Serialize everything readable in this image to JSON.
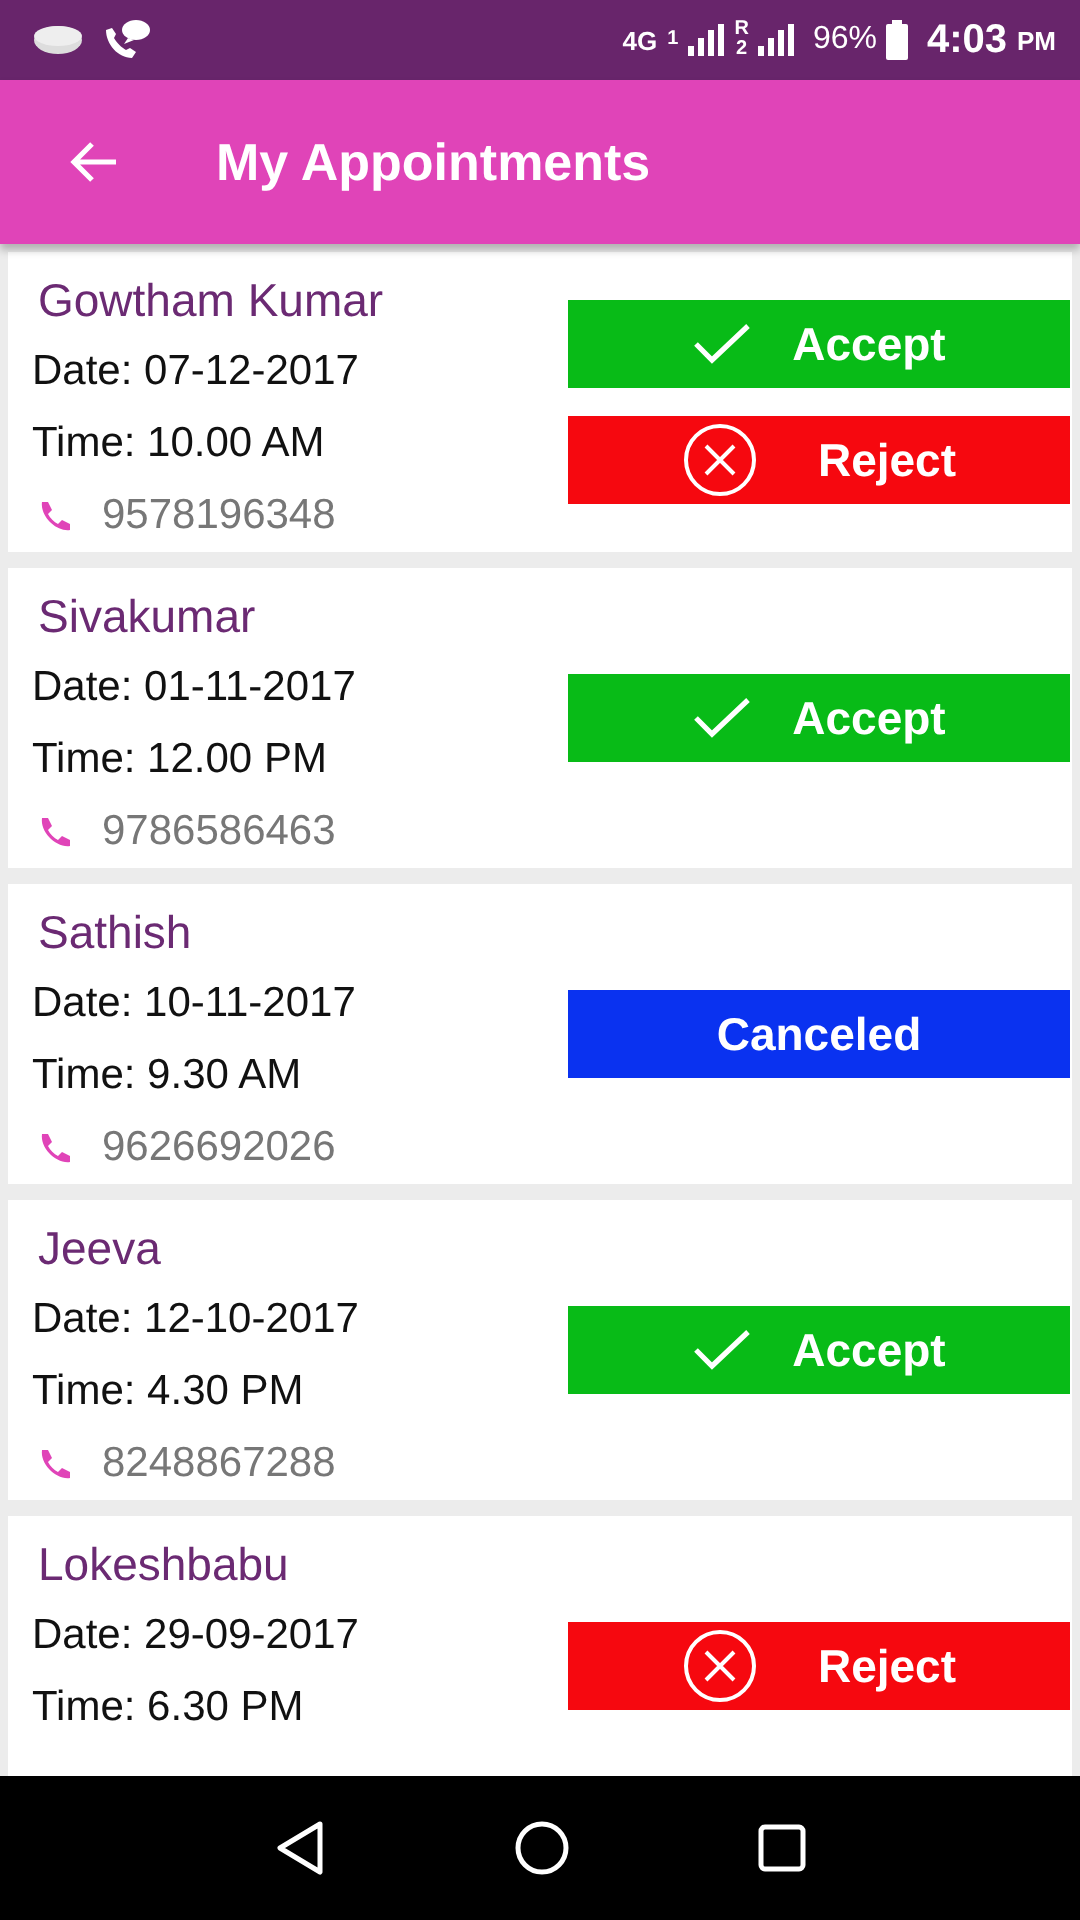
{
  "status_bar": {
    "network": "4G",
    "sim1": "1",
    "roaming": "R",
    "sim2": "2",
    "battery": "96%",
    "time": "4:03",
    "time_suffix": "PM"
  },
  "header": {
    "title": "My Appointments"
  },
  "appointments": [
    {
      "name": "Gowtham Kumar",
      "date": "Date: 07-12-2017",
      "time": "Time: 10.00 AM",
      "phone": "9578196348",
      "actions": [
        {
          "kind": "accept",
          "label": "Accept"
        },
        {
          "kind": "reject",
          "label": "Reject"
        }
      ]
    },
    {
      "name": "Sivakumar",
      "date": "Date: 01-11-2017",
      "time": "Time: 12.00 PM",
      "phone": "9786586463",
      "actions": [
        {
          "kind": "accept",
          "label": "Accept"
        }
      ]
    },
    {
      "name": "Sathish",
      "date": "Date: 10-11-2017",
      "time": "Time: 9.30 AM",
      "phone": "9626692026",
      "actions": [
        {
          "kind": "canceled",
          "label": "Canceled"
        }
      ]
    },
    {
      "name": "Jeeva",
      "date": "Date: 12-10-2017",
      "time": "Time: 4.30 PM",
      "phone": "8248867288",
      "actions": [
        {
          "kind": "accept",
          "label": "Accept"
        }
      ]
    },
    {
      "name": "Lokeshbabu",
      "date": "Date: 29-09-2017",
      "time": "Time: 6.30 PM",
      "actions": [
        {
          "kind": "reject",
          "label": "Reject"
        }
      ]
    }
  ]
}
